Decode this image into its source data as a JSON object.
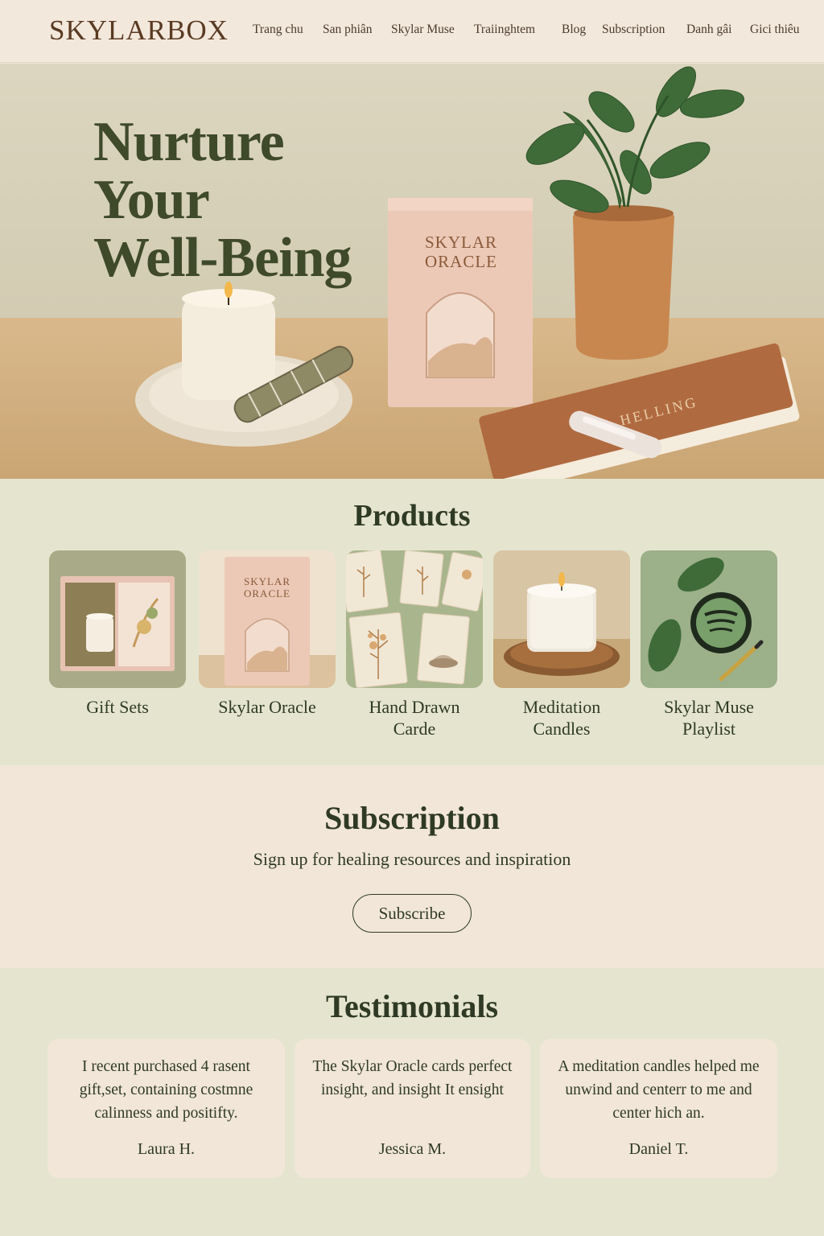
{
  "brand": {
    "logo": "SKYLARBOX"
  },
  "nav": {
    "items": [
      "Trang chu",
      "San phiân",
      "Skylar Muse",
      "Traiinghtem",
      "Blog",
      "Subscription",
      "Danh gâi",
      "Gici thiêu"
    ]
  },
  "hero": {
    "title_lines": [
      "Nurture",
      "Your",
      "Well-Being"
    ],
    "oracle_box": {
      "line1": "SKYLAR",
      "line2": "ORACLE"
    },
    "book_title": "HELLING"
  },
  "products": {
    "title": "Products",
    "items": [
      {
        "label_lines": [
          "Gift Sets"
        ],
        "icon": "gift-set-image"
      },
      {
        "label_lines": [
          "Skylar Oracle"
        ],
        "icon": "oracle-box-image",
        "box_line1": "SKYLAR",
        "box_line2": "ORACLE"
      },
      {
        "label_lines": [
          "Hand  Drawn",
          "Carde"
        ],
        "icon": "hand-drawn-cards-image"
      },
      {
        "label_lines": [
          "Meditation",
          "Candles"
        ],
        "icon": "candle-image"
      },
      {
        "label_lines": [
          "Skylar Muse",
          "Playlist"
        ],
        "icon": "playlist-image"
      }
    ]
  },
  "subscription": {
    "title": "Subscription",
    "text": "Sign up for healing resources and inspiration",
    "button_label": "Subscribe"
  },
  "testimonials": {
    "title": "Testimonials",
    "items": [
      {
        "quote": "I recent purchased 4 rasent gift,set, containing costmne calinness and positifty.",
        "author": "Laura H."
      },
      {
        "quote": "The Skylar Oracle cards perfect insight, and insight It ensight",
        "author": "Jessica M."
      },
      {
        "quote": "A meditation candles helped me unwind and centerr to me and center hich an.",
        "author": "Daniel T."
      }
    ]
  },
  "colors": {
    "header_bg": "#f3e8dc",
    "logo": "#5a3a22",
    "products_bg": "#e5e5cf",
    "subscription_bg": "#f1e6d8",
    "card_bg": "#f1e6d8",
    "text_dark_green": "#2f3a25"
  }
}
